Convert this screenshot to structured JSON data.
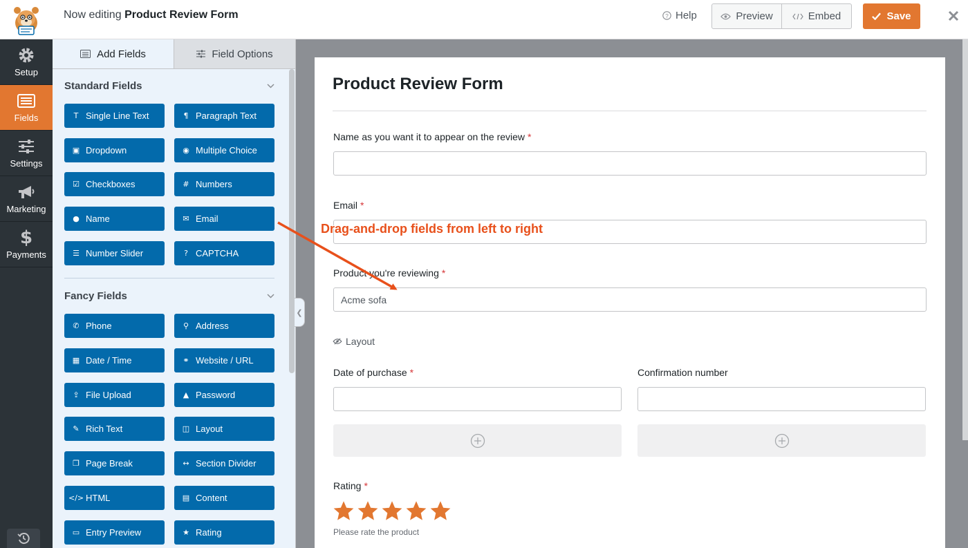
{
  "topbar": {
    "title_prefix": "Now editing",
    "form_name": "Product Review Form",
    "help_label": "Help",
    "preview_label": "Preview",
    "embed_label": "Embed",
    "save_label": "Save"
  },
  "nav": {
    "items": [
      {
        "label": "Setup",
        "icon": "gear-icon"
      },
      {
        "label": "Fields",
        "icon": "fields-icon"
      },
      {
        "label": "Settings",
        "icon": "sliders-icon"
      },
      {
        "label": "Marketing",
        "icon": "megaphone-icon"
      },
      {
        "label": "Payments",
        "icon": "dollar-icon"
      }
    ],
    "active": "Fields"
  },
  "panel": {
    "tabs": [
      {
        "label": "Add Fields",
        "icon": "list-icon"
      },
      {
        "label": "Field Options",
        "icon": "sliders-icon"
      }
    ],
    "standard_heading": "Standard Fields",
    "standard_fields": [
      {
        "label": "Single Line Text",
        "icon": "text-icon"
      },
      {
        "label": "Paragraph Text",
        "icon": "paragraph-icon"
      },
      {
        "label": "Dropdown",
        "icon": "dropdown-icon"
      },
      {
        "label": "Multiple Choice",
        "icon": "radio-icon"
      },
      {
        "label": "Checkboxes",
        "icon": "checkbox-icon"
      },
      {
        "label": "Numbers",
        "icon": "hash-icon"
      },
      {
        "label": "Name",
        "icon": "user-icon"
      },
      {
        "label": "Email",
        "icon": "envelope-icon"
      },
      {
        "label": "Number Slider",
        "icon": "slider-icon"
      },
      {
        "label": "CAPTCHA",
        "icon": "question-icon"
      }
    ],
    "fancy_heading": "Fancy Fields",
    "fancy_fields": [
      {
        "label": "Phone",
        "icon": "phone-icon"
      },
      {
        "label": "Address",
        "icon": "map-pin-icon"
      },
      {
        "label": "Date / Time",
        "icon": "calendar-icon"
      },
      {
        "label": "Website / URL",
        "icon": "link-icon"
      },
      {
        "label": "File Upload",
        "icon": "upload-icon"
      },
      {
        "label": "Password",
        "icon": "lock-icon"
      },
      {
        "label": "Rich Text",
        "icon": "edit-icon"
      },
      {
        "label": "Layout",
        "icon": "columns-icon"
      },
      {
        "label": "Page Break",
        "icon": "copy-icon"
      },
      {
        "label": "Section Divider",
        "icon": "arrows-h-icon"
      },
      {
        "label": "HTML",
        "icon": "code-icon"
      },
      {
        "label": "Content",
        "icon": "image-file-icon"
      },
      {
        "label": "Entry Preview",
        "icon": "file-text-icon"
      },
      {
        "label": "Rating",
        "icon": "star-icon"
      }
    ]
  },
  "form": {
    "title": "Product Review Form",
    "name_label": "Name as you want it to appear on the review",
    "email_label": "Email",
    "product_label": "Product you're reviewing",
    "product_value": "Acme sofa",
    "layout_label": "Layout",
    "date_label": "Date of purchase",
    "confirmation_label": "Confirmation number",
    "rating_label": "Rating",
    "rating_value": 5,
    "rating_hint": "Please rate the product",
    "required_mark": "*"
  },
  "annotation": {
    "text": "Drag-and-drop fields from left to right"
  },
  "colors": {
    "accent": "#e27730",
    "field_button": "#036aab",
    "nav_bg": "#2c3338",
    "panel_bg": "#ebf3fb",
    "preview_bg": "#8c8f94",
    "star": "#e27730",
    "annotation": "#e8501b",
    "required": "#d63638"
  }
}
